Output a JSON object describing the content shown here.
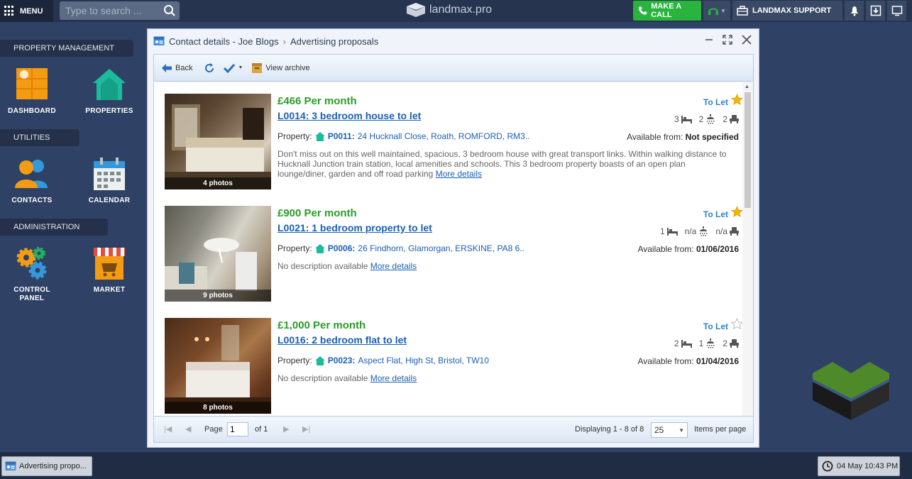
{
  "topbar": {
    "menu_label": "MENU",
    "search_placeholder": "Type to search ...",
    "logo_text": "landmax.pro",
    "call_label": "MAKE A CALL",
    "support_label": "LANDMAX SUPPORT"
  },
  "sidebar": {
    "sections": [
      {
        "title": "PROPERTY MANAGEMENT",
        "apps": [
          "DASHBOARD",
          "PROPERTIES"
        ]
      },
      {
        "title": "UTILITIES",
        "apps": [
          "CONTACTS",
          "CALENDAR"
        ]
      },
      {
        "title": "ADMINISTRATION",
        "apps": [
          "CONTROL PANEL",
          "MARKET"
        ]
      }
    ]
  },
  "window": {
    "breadcrumb": [
      "Contact details - Joe Blogs",
      "Advertising proposals"
    ],
    "toolbar": {
      "back_label": "Back",
      "archive_label": "View archive"
    },
    "listings": [
      {
        "price": "£466 Per month",
        "ref": "L0014:  3 bedroom house to let",
        "status": "To Let",
        "starred": true,
        "beds": "3",
        "baths": "2",
        "receptions": "2",
        "property_label": "Property:",
        "property_code": "P0011:",
        "property_address": "24 Hucknall Close, Roath, ROMFORD, RM3..",
        "available_label": "Available from:",
        "available_value": "Not specified",
        "description": "Don't miss out on this well maintained, spacious, 3 bedroom house with great transport links. Within walking distance to Hucknall Junction train station, local amenities and schools. This 3 bedroom property boasts of an open plan lounge/diner, garden and off road parking",
        "more_label": "More details",
        "photos": "4 photos"
      },
      {
        "price": "£900 Per month",
        "ref": "L0021:  1 bedroom property to let",
        "status": "To Let",
        "starred": true,
        "beds": "1",
        "baths": "n/a",
        "receptions": "n/a",
        "property_label": "Property:",
        "property_code": "P0006:",
        "property_address": "26 Findhorn, Glamorgan, ERSKINE, PA8 6..",
        "available_label": "Available from:",
        "available_value": "01/06/2016",
        "description": "No description available",
        "more_label": "More details",
        "photos": "9 photos"
      },
      {
        "price": "£1,000 Per month",
        "ref": "L0016:  2 bedroom flat to let",
        "status": "To Let",
        "starred": false,
        "beds": "2",
        "baths": "1",
        "receptions": "2",
        "property_label": "Property:",
        "property_code": "P0023:",
        "property_address": "Aspect Flat, High St, Bristol, TW10",
        "available_label": "Available from:",
        "available_value": "01/04/2016",
        "description": "No description available",
        "more_label": "More details",
        "photos": "8 photos"
      }
    ],
    "pager": {
      "page_label": "Page",
      "page_value": "1",
      "of_label": "of 1",
      "displaying": "Displaying 1 - 8 of 8",
      "per_page_value": "25",
      "per_page_label": "Items per page"
    }
  },
  "taskbar": {
    "task_label": "Advertising propo...",
    "clock": "04 May 10:43 PM"
  },
  "colors": {
    "accent_green": "#29b43e",
    "price_green": "#2a9d2a",
    "link_blue": "#1a5fb4",
    "status_blue": "#2e84c8"
  }
}
